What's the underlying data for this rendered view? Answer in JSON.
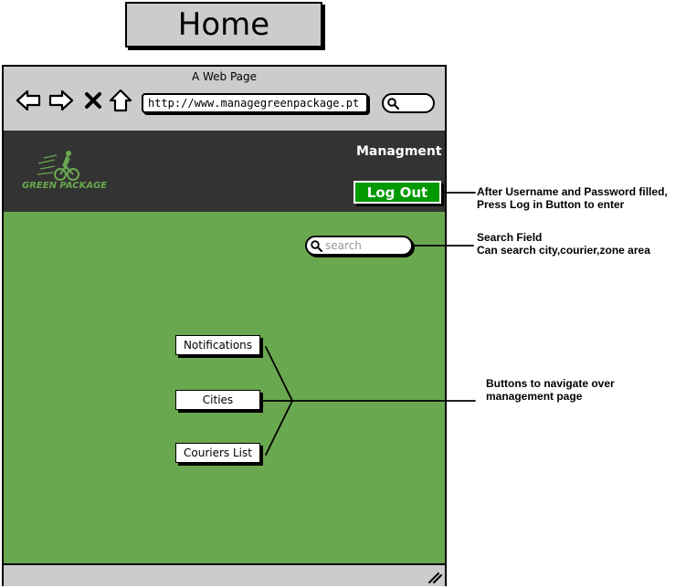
{
  "page_label": "Home",
  "browser": {
    "window_title": "A Web Page",
    "url": "http://www.managegreenpackage.pt",
    "icons": [
      "back-arrow-icon",
      "forward-arrow-icon",
      "stop-x-icon",
      "home-icon",
      "search-icon"
    ]
  },
  "header": {
    "brand_name": "GREEN PACKAGE",
    "section_label": "Managment",
    "logout_label": "Log Out",
    "colors": {
      "background": "#333333",
      "logout_button": "#009900",
      "brand": "#6aa84f"
    }
  },
  "main": {
    "background": "#6aa84f",
    "search_placeholder": "search",
    "nav_buttons": [
      {
        "label": "Notifications"
      },
      {
        "label": "Cities"
      },
      {
        "label": "Couriers List"
      }
    ]
  },
  "annotations": {
    "login": [
      "After Username and Password filled,",
      "Press Log in Button to enter"
    ],
    "search": [
      "Search Field",
      "Can search city,courier,zone area"
    ],
    "buttons": [
      "Buttons to navigate over",
      "management page"
    ]
  }
}
